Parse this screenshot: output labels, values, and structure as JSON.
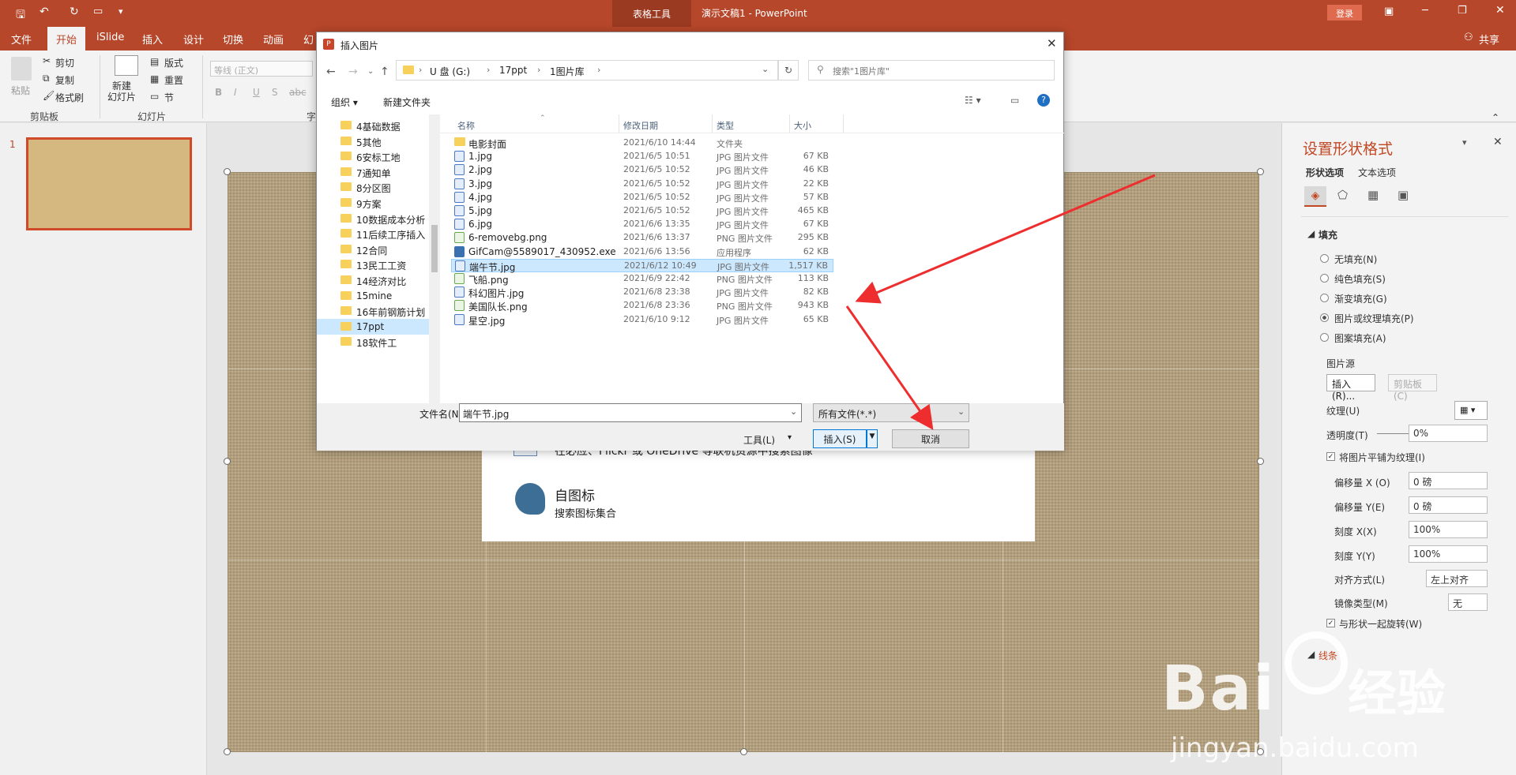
{
  "titlebar": {
    "tools_label": "表格工具",
    "title": "演示文稿1  -  PowerPoint",
    "login_label": "登录",
    "share_label": "共享"
  },
  "tabs": [
    "文件",
    "开始",
    "iSlide",
    "插入",
    "设计",
    "切换",
    "动画",
    "幻"
  ],
  "ribbon": {
    "paste": "粘贴",
    "cut": "剪切",
    "copy": "复制",
    "format_painter": "格式刷",
    "new_slide": "新建\n幻灯片",
    "layout": "版式",
    "reset": "重置",
    "section": "节",
    "font_placeholder": "等线 (正文)",
    "group_clipboard": "剪贴板",
    "group_slides": "幻灯片",
    "group_font_short": "字"
  },
  "thumb": {
    "number": "1"
  },
  "panel": {
    "title": "设置形状格式",
    "tab_shape": "形状选项",
    "tab_text": "文本选项",
    "section_fill": "填充",
    "fill_options": [
      "无填充(N)",
      "纯色填充(S)",
      "渐变填充(G)",
      "图片或纹理填充(P)",
      "图案填充(A)"
    ],
    "picture_source": "图片源",
    "insert_btn": "插入(R)...",
    "clipboard_btn": "剪贴板(C)",
    "texture": "纹理(U)",
    "transparency": "透明度(T)",
    "transparency_val": "0%",
    "tile_check": "将图片平铺为纹理(I)",
    "offset_x": "偏移量 X (O)",
    "offset_x_val": "0 磅",
    "offset_y": "偏移量 Y(E)",
    "offset_y_val": "0 磅",
    "scale_x": "刻度 X(X)",
    "scale_x_val": "100%",
    "scale_y": "刻度 Y(Y)",
    "scale_y_val": "100%",
    "align": "对齐方式(L)",
    "align_val": "左上对齐",
    "mirror": "镜像类型(M)",
    "mirror_val": "无",
    "rotate_check": "与形状一起旋转(W)",
    "line_section": "线条"
  },
  "search_panel": {
    "row1": "在必应、Flickr 或 OneDrive 等联机资源中搜索图像",
    "icon_title": "自图标",
    "icon_sub": "搜索图标集合"
  },
  "dialog": {
    "title": "插入图片",
    "path": [
      "U 盘 (G:)",
      "17ppt",
      "1图片库"
    ],
    "search_placeholder": "搜索\"1图片库\"",
    "organize": "组织 ▾",
    "new_folder": "新建文件夹",
    "nav": [
      "4基础数据",
      "5其他",
      "6安标工地",
      "7通知单",
      "8分区图",
      "9方案",
      "10数据成本分析",
      "11后续工序插入",
      "12合同",
      "13民工工资",
      "14经济对比",
      "15mine",
      "16年前钢筋计划",
      "17ppt",
      "18软件工"
    ],
    "headers": {
      "name": "名称",
      "date": "修改日期",
      "type": "类型",
      "size": "大小"
    },
    "files": [
      {
        "name": "电影封面",
        "date": "2021/6/10 14:44",
        "type": "文件夹",
        "size": "",
        "icon": "folder"
      },
      {
        "name": "1.jpg",
        "date": "2021/6/5 10:51",
        "type": "JPG 图片文件",
        "size": "67 KB",
        "icon": "jpg"
      },
      {
        "name": "2.jpg",
        "date": "2021/6/5 10:52",
        "type": "JPG 图片文件",
        "size": "46 KB",
        "icon": "jpg"
      },
      {
        "name": "3.jpg",
        "date": "2021/6/5 10:52",
        "type": "JPG 图片文件",
        "size": "22 KB",
        "icon": "jpg"
      },
      {
        "name": "4.jpg",
        "date": "2021/6/5 10:52",
        "type": "JPG 图片文件",
        "size": "57 KB",
        "icon": "jpg"
      },
      {
        "name": "5.jpg",
        "date": "2021/6/5 10:52",
        "type": "JPG 图片文件",
        "size": "465 KB",
        "icon": "jpg"
      },
      {
        "name": "6.jpg",
        "date": "2021/6/6 13:35",
        "type": "JPG 图片文件",
        "size": "67 KB",
        "icon": "jpg"
      },
      {
        "name": "6-removebg.png",
        "date": "2021/6/6 13:37",
        "type": "PNG 图片文件",
        "size": "295 KB",
        "icon": "png"
      },
      {
        "name": "GifCam@5589017_430952.exe",
        "date": "2021/6/6 13:56",
        "type": "应用程序",
        "size": "62 KB",
        "icon": "exe"
      },
      {
        "name": "端午节.jpg",
        "date": "2021/6/12 10:49",
        "type": "JPG 图片文件",
        "size": "1,517 KB",
        "icon": "jpg"
      },
      {
        "name": "飞船.png",
        "date": "2021/6/9 22:42",
        "type": "PNG 图片文件",
        "size": "113 KB",
        "icon": "png"
      },
      {
        "name": "科幻图片.jpg",
        "date": "2021/6/8 23:38",
        "type": "JPG 图片文件",
        "size": "82 KB",
        "icon": "jpg"
      },
      {
        "name": "美国队长.png",
        "date": "2021/6/8 23:36",
        "type": "PNG 图片文件",
        "size": "943 KB",
        "icon": "png"
      },
      {
        "name": "星空.jpg",
        "date": "2021/6/10 9:12",
        "type": "JPG 图片文件",
        "size": "65 KB",
        "icon": "jpg"
      }
    ],
    "selected_index": 9,
    "filename_label": "文件名(N):",
    "filename_value": "端午节.jpg",
    "filter_value": "所有文件(*.*)",
    "tools": "工具(L)",
    "insert": "插入(S)",
    "cancel": "取消"
  },
  "watermark": {
    "brand": "Bai",
    "brand2": "经验",
    "url": "jingyan.baidu.com"
  }
}
